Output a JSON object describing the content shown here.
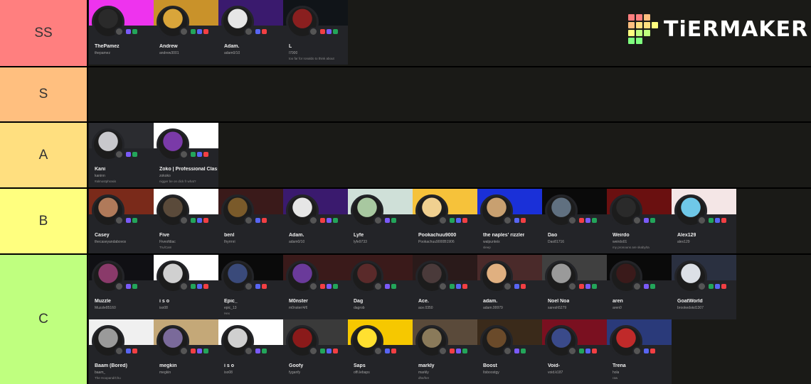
{
  "brand": {
    "logo_text": "TiERMAKER"
  },
  "tiers": [
    {
      "label": "SS",
      "color": "#ff7f7f",
      "items": [
        {
          "name": "ThePamez",
          "handle": "thepamez",
          "extra": "",
          "banner": "#ee33ee",
          "avatar": "#2a2a2a"
        },
        {
          "name": "Andrew",
          "handle": "andrew3001",
          "extra": "",
          "banner": "#c9922a",
          "avatar": "#d9a53a"
        },
        {
          "name": "Adam.",
          "handle": "adam0/10",
          "extra": "",
          "banner": "#3a1a6e",
          "avatar": "#e6e6e6"
        },
        {
          "name": "L",
          "handle": "l7000",
          "extra": "too far for ronaldo to think about",
          "banner": "#101418",
          "avatar": "#8a1f1f"
        }
      ]
    },
    {
      "label": "S",
      "color": "#ffbf7f",
      "items": []
    },
    {
      "label": "A",
      "color": "#ffdf7f",
      "items": [
        {
          "name": "Kani",
          "handle": "kaninn",
          "extra": "#almostphrasis",
          "banner": "#2b2c30",
          "avatar": "#c8c8cc"
        },
        {
          "name": "Zoko | Professional Class",
          "handle": "zokoko",
          "extra": "nigger be on dick fr what?",
          "banner": "#ffffff",
          "avatar": "#7a3aa8"
        }
      ]
    },
    {
      "label": "B",
      "color": "#ffff7f",
      "items": [
        {
          "name": "Casey",
          "handle": "thecaseyandabovos",
          "extra": "",
          "banner": "#7a2a1a",
          "avatar": "#b07a5a"
        },
        {
          "name": "Five",
          "handle": "Fiveofdiac",
          "extra": "Tru/Cam",
          "banner": "#ffffff",
          "avatar": "#5a4a3a"
        },
        {
          "name": "benl",
          "handle": "Ihyrrnri",
          "extra": "",
          "banner": "#3a1a1a",
          "avatar": "#7a5a2a"
        },
        {
          "name": "Adam.",
          "handle": "adam0/10",
          "extra": "",
          "banner": "#3a1a6e",
          "avatar": "#e6e6e6"
        },
        {
          "name": "Lyfe",
          "handle": "lyfe9733",
          "extra": "",
          "banner": "#cfe0d8",
          "avatar": "#a8c8a0"
        },
        {
          "name": "Pookachuu9000",
          "handle": "Pookachuu9000B1906",
          "extra": "",
          "banner": "#f6c23a",
          "avatar": "#f0d090"
        },
        {
          "name": "the naples' rizzler",
          "handle": "walpunteix",
          "extra": "sleep",
          "banner": "#1a30d8",
          "avatar": "#c8a070"
        },
        {
          "name": "Dao",
          "handle": "Dao81716",
          "extra": "",
          "banner": "#0a0a0a",
          "avatar": "#607080"
        },
        {
          "name": "Weirdo",
          "handle": "weirdo01",
          "extra": "my pronouns are skaby/ta",
          "banner": "#6a1010",
          "avatar": "#2a2a2a"
        },
        {
          "name": "Alex129",
          "handle": "alex129",
          "extra": "",
          "banner": "#f4e6e6",
          "avatar": "#6fc8e8"
        }
      ]
    },
    {
      "label": "C",
      "color": "#bfff7f",
      "items": [
        {
          "name": "Muzzle",
          "handle": "Muzzle85160",
          "extra": "",
          "banner": "#101014",
          "avatar": "#8a3a6a"
        },
        {
          "name": "i s o",
          "handle": "iso08",
          "extra": "",
          "banner": "#ffffff",
          "avatar": "#d0d0d0"
        },
        {
          "name": "Epic_",
          "handle": "epic_13",
          "extra": "Hex",
          "banner": "#0a0a0a",
          "avatar": "#3a4a7a"
        },
        {
          "name": "M0nster",
          "handle": "m0nster/4/6",
          "extra": "",
          "banner": "#3a1a1a",
          "avatar": "#6a3a9a"
        },
        {
          "name": "Dag",
          "handle": "dagrob",
          "extra": "",
          "banner": "#3a1a1a",
          "avatar": "#5a2a2a"
        },
        {
          "name": "Ace.",
          "handle": "ace.0350",
          "extra": "",
          "banner": "#2a1a1a",
          "avatar": "#4a3a3a"
        },
        {
          "name": "adam.",
          "handle": "adam.99979",
          "extra": "",
          "banner": "#4a2a2a",
          "avatar": "#e0b080"
        },
        {
          "name": "Noel Noa",
          "handle": "saresh5279",
          "extra": "",
          "banner": "#404040",
          "avatar": "#9a9a9a"
        },
        {
          "name": "aren",
          "handle": "aren0",
          "extra": "",
          "banner": "#0a0a0a",
          "avatar": "#3a1a1a"
        },
        {
          "name": "GoatWorld",
          "handle": "brookedskd1307",
          "extra": "",
          "banner": "#2a3040",
          "avatar": "#dce0e6"
        },
        {
          "name": "Baam (Bored)",
          "handle": "baam_",
          "extra": "The Hoopand/Chu",
          "banner": "#f0f0f0",
          "avatar": "#9a9a9a"
        },
        {
          "name": "megkin",
          "handle": "megkin",
          "extra": "",
          "banner": "#c4a878",
          "avatar": "#7a6a9a"
        },
        {
          "name": "i s o",
          "handle": "iso08",
          "extra": "",
          "banner": "#ffffff",
          "avatar": "#d0d0d0"
        },
        {
          "name": "Goofy",
          "handle": "fyganfy",
          "extra": "",
          "banner": "#3a3a3a",
          "avatar": "#8a1a1a"
        },
        {
          "name": "Saps",
          "handle": "offi.lebaps",
          "extra": "",
          "banner": "#f6c800",
          "avatar": "#ffe030"
        },
        {
          "name": "markly",
          "handle": "markly",
          "extra": "dhe/her",
          "banner": "#5a4a3a",
          "avatar": "#8a7a5a"
        },
        {
          "name": "Boost",
          "handle": "Itsboostgy",
          "extra": "",
          "banner": "#3a2a1a",
          "avatar": "#6a4a2a"
        },
        {
          "name": "Void-",
          "handle": "void.k187",
          "extra": "",
          "banner": "#7a1020",
          "avatar": "#3a4a8a"
        },
        {
          "name": "Trena",
          "handle": "hola",
          "extra": "raw",
          "banner": "#2a3a7a",
          "avatar": "#c02a2a"
        }
      ]
    }
  ]
}
